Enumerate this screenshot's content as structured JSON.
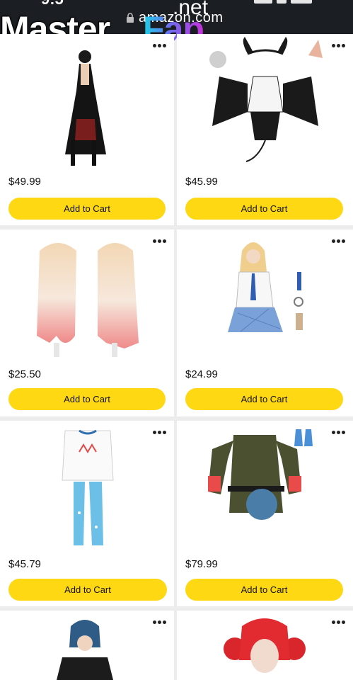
{
  "status": {
    "time": "9:5"
  },
  "address_bar": {
    "url": "amazon.com"
  },
  "watermark": {
    "brand_white": "Master",
    "brand_color": "Fap",
    "suffix": ".net"
  },
  "products": [
    {
      "price": "$49.99",
      "cta": "Add to Cart",
      "image": "black-gothic-dress-costume"
    },
    {
      "price": "$45.99",
      "cta": "Add to Cart",
      "image": "devil-bat-wing-outfit"
    },
    {
      "price": "$25.50",
      "cta": "Add to Cart",
      "image": "blonde-pink-gradient-wig"
    },
    {
      "price": "$24.99",
      "cta": "Add to Cart",
      "image": "schoolgirl-plaid-uniform"
    },
    {
      "price": "$45.79",
      "cta": "Add to Cart",
      "image": "white-top-blue-pants-set"
    },
    {
      "price": "$79.99",
      "cta": "Add to Cart",
      "image": "military-green-dress-set"
    },
    {
      "price": "",
      "cta": "",
      "image": "blue-hair-leather-jacket"
    },
    {
      "price": "",
      "cta": "",
      "image": "red-pigtail-wig"
    }
  ],
  "colors": {
    "cart_button": "#ffd814",
    "topbar": "#1b1e22",
    "card_bg": "#ffffff"
  }
}
